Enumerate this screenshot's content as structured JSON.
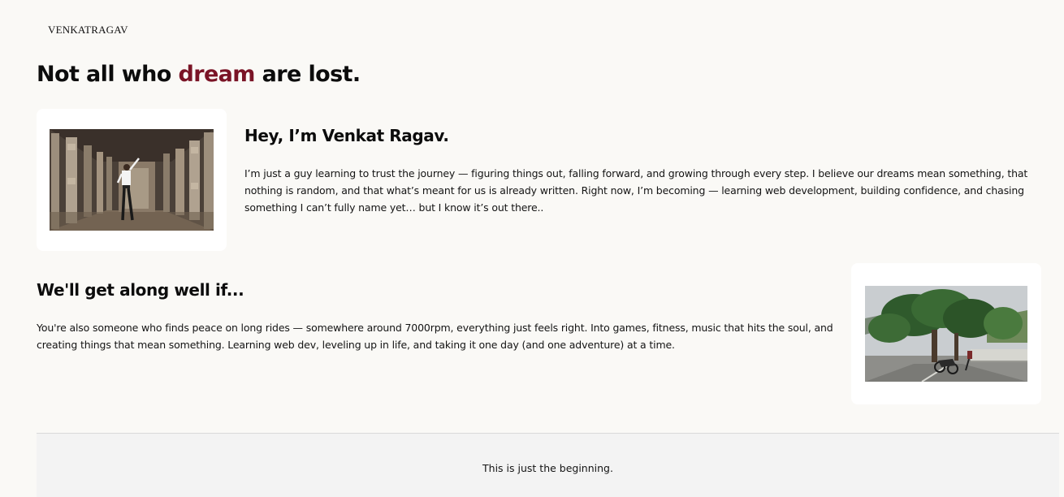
{
  "brand": {
    "logo_text": "VENKATRAGAV"
  },
  "hero": {
    "headline_before": "Not all who ",
    "headline_accent": "dream",
    "headline_after": " are lost."
  },
  "intro": {
    "heading": "Hey, I’m Venkat Ragav.",
    "text": "I’m just a guy learning to trust the journey — figuring things out, falling forward, and growing through every step. I believe our dreams mean something, that nothing is random, and that what’s meant for us is already written. Right now, I’m becoming — learning web development, building confidence, and chasing something I can’t fully name yet… but I know it’s out there..",
    "photo_icon": "photo-temple-corridor"
  },
  "along": {
    "heading": "We'll get along well if...",
    "text": "You're also someone who finds peace on long rides — somewhere around 7000rpm, everything just feels right. Into games, fitness, music that hits the soul, and creating things that mean something. Learning web dev, leveling up in life, and taking it one day (and one adventure) at a time.",
    "photo_icon": "photo-tree-road-motorbike"
  },
  "footer": {
    "text": "This is just the beginning."
  },
  "colors": {
    "background": "#faf9f6",
    "accent": "#7a1426",
    "text": "#111111",
    "footer_bg": "#f3f3f3"
  }
}
